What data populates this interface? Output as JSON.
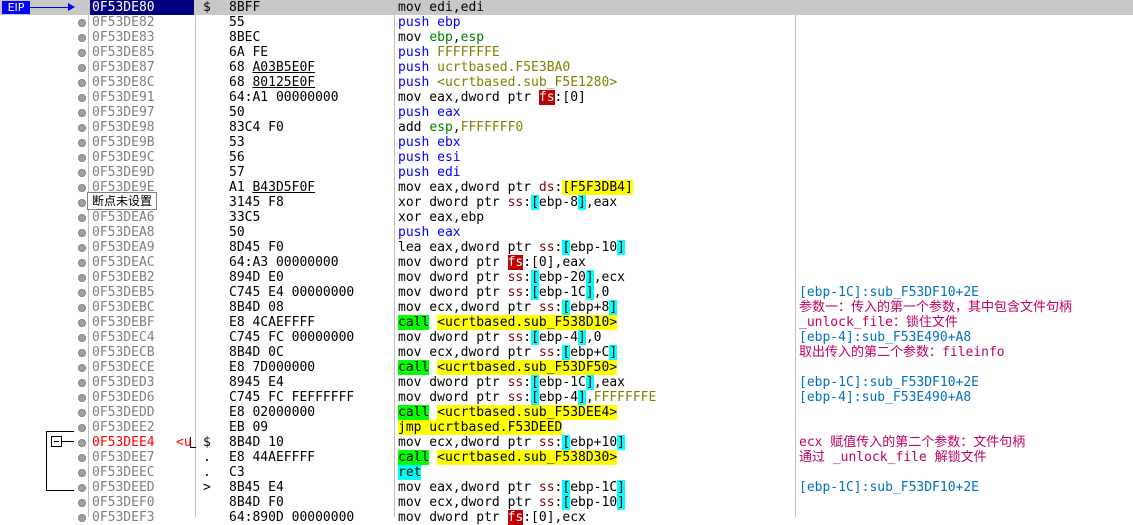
{
  "eip_label": "EIP",
  "tooltip": "断点未设置",
  "row_prefix": "<u",
  "rows": [
    {
      "addr": "0F53DE80",
      "mark": "$",
      "bytes": "8BFF",
      "asm": [
        [
          "k-mov",
          "mov edi,edi"
        ]
      ],
      "cmt": "",
      "eip": true
    },
    {
      "addr": "0F53DE82",
      "mark": "",
      "bytes": "55",
      "asm": [
        [
          "k-push",
          "push ebp"
        ]
      ],
      "cmt": ""
    },
    {
      "addr": "0F53DE83",
      "mark": "",
      "bytes": "8BEC",
      "asm": [
        [
          "k-mov",
          "mov "
        ],
        [
          "k-reg",
          "ebp"
        ],
        [
          "k-lit",
          ","
        ],
        [
          "k-reg",
          "esp"
        ]
      ],
      "cmt": ""
    },
    {
      "addr": "0F53DE85",
      "mark": "",
      "bytes": "6A FE",
      "asm": [
        [
          "k-push",
          "push "
        ],
        [
          "k-num",
          "FFFFFFFE"
        ]
      ],
      "cmt": ""
    },
    {
      "addr": "0F53DE87",
      "mark": "",
      "bytes": "68 A03B5E0F",
      "asm": [
        [
          "k-push",
          "push "
        ],
        [
          "k-sym",
          "ucrtbased.F5E3BA0"
        ]
      ],
      "cmt": "",
      "ul": true
    },
    {
      "addr": "0F53DE8C",
      "mark": "",
      "bytes": "68 80125E0F",
      "asm": [
        [
          "k-push",
          "push "
        ],
        [
          "k-sym",
          "<ucrtbased.sub_F5E1280>"
        ]
      ],
      "cmt": "",
      "ul": true
    },
    {
      "addr": "0F53DE91",
      "mark": "",
      "bytes": "64:A1 00000000",
      "asm": [
        [
          "k-mov",
          "mov eax,dword ptr "
        ],
        [
          "k-fs",
          "fs"
        ],
        [
          "k-lit",
          ":[0]"
        ]
      ],
      "cmt": ""
    },
    {
      "addr": "0F53DE97",
      "mark": "",
      "bytes": "50",
      "asm": [
        [
          "k-push",
          "push eax"
        ]
      ],
      "cmt": ""
    },
    {
      "addr": "0F53DE98",
      "mark": "",
      "bytes": "83C4 F0",
      "asm": [
        [
          "k-add",
          "add "
        ],
        [
          "k-reg",
          "esp"
        ],
        [
          "k-lit",
          ","
        ],
        [
          "k-num",
          "FFFFFFF0"
        ]
      ],
      "cmt": ""
    },
    {
      "addr": "0F53DE9B",
      "mark": "",
      "bytes": "53",
      "asm": [
        [
          "k-push",
          "push ebx"
        ]
      ],
      "cmt": ""
    },
    {
      "addr": "0F53DE9C",
      "mark": "",
      "bytes": "56",
      "asm": [
        [
          "k-push",
          "push esi"
        ]
      ],
      "cmt": ""
    },
    {
      "addr": "0F53DE9D",
      "mark": "",
      "bytes": "57",
      "asm": [
        [
          "k-push",
          "push edi"
        ]
      ],
      "cmt": ""
    },
    {
      "addr": "0F53DE9E",
      "mark": "",
      "bytes": "A1 B43D5F0F",
      "asm": [
        [
          "k-mov",
          "mov eax,dword ptr "
        ],
        [
          "k-seg",
          "ds"
        ],
        [
          "k-lit",
          ":"
        ],
        [
          "k-ds",
          "[F5F3DB4]"
        ]
      ],
      "cmt": "",
      "ul": true
    },
    {
      "addr": "0F53DEA3",
      "mark": "",
      "bytes": "3145 F8",
      "asm": [
        [
          "k-xor",
          "xor dword ptr "
        ],
        [
          "k-seg",
          "ss"
        ],
        [
          "k-lit",
          ":"
        ],
        [
          "k-brk",
          "["
        ],
        [
          "k-lit",
          "ebp-8"
        ],
        [
          "k-brk",
          "]"
        ],
        [
          "k-lit",
          ",eax"
        ]
      ],
      "cmt": ""
    },
    {
      "addr": "0F53DEA6",
      "mark": "",
      "bytes": "33C5",
      "asm": [
        [
          "k-xor",
          "xor eax,ebp"
        ]
      ],
      "cmt": ""
    },
    {
      "addr": "0F53DEA8",
      "mark": "",
      "bytes": "50",
      "asm": [
        [
          "k-push",
          "push eax"
        ]
      ],
      "cmt": ""
    },
    {
      "addr": "0F53DEA9",
      "mark": "",
      "bytes": "8D45 F0",
      "asm": [
        [
          "k-lea",
          "lea eax,dword ptr "
        ],
        [
          "k-seg",
          "ss"
        ],
        [
          "k-lit",
          ":"
        ],
        [
          "k-brk",
          "["
        ],
        [
          "k-lit",
          "ebp-10"
        ],
        [
          "k-brk",
          "]"
        ]
      ],
      "cmt": ""
    },
    {
      "addr": "0F53DEAC",
      "mark": "",
      "bytes": "64:A3 00000000",
      "asm": [
        [
          "k-mov",
          "mov dword ptr "
        ],
        [
          "k-fs",
          "fs"
        ],
        [
          "k-lit",
          ":[0],eax"
        ]
      ],
      "cmt": ""
    },
    {
      "addr": "0F53DEB2",
      "mark": "",
      "bytes": "894D E0",
      "asm": [
        [
          "k-mov",
          "mov dword ptr "
        ],
        [
          "k-seg",
          "ss"
        ],
        [
          "k-lit",
          ":"
        ],
        [
          "k-brk",
          "["
        ],
        [
          "k-lit",
          "ebp-20"
        ],
        [
          "k-brk",
          "]"
        ],
        [
          "k-lit",
          ",ecx"
        ]
      ],
      "cmt": ""
    },
    {
      "addr": "0F53DEB5",
      "mark": "",
      "bytes": "C745 E4 00000000",
      "asm": [
        [
          "k-mov",
          "mov dword ptr "
        ],
        [
          "k-seg",
          "ss"
        ],
        [
          "k-lit",
          ":"
        ],
        [
          "k-brk",
          "["
        ],
        [
          "k-lit",
          "ebp-1C"
        ],
        [
          "k-brk",
          "]"
        ],
        [
          "k-lit",
          ",0"
        ]
      ],
      "cmt": "[ebp-1C]:sub_F53DF10+2E",
      "cc": "cm-blue"
    },
    {
      "addr": "0F53DEBC",
      "mark": "",
      "bytes": "8B4D 08",
      "asm": [
        [
          "k-mov",
          "mov ecx,dword ptr "
        ],
        [
          "k-seg",
          "ss"
        ],
        [
          "k-lit",
          ":"
        ],
        [
          "k-brk",
          "["
        ],
        [
          "k-lit",
          "ebp+8"
        ],
        [
          "k-brk",
          "]"
        ]
      ],
      "cmt": "参数一：传入的第一个参数，其中包含文件句柄",
      "cc": "cm-red"
    },
    {
      "addr": "0F53DEBF",
      "mark": "",
      "bytes": "E8 4CAEFFFF",
      "asm": [
        [
          "k-call",
          "call"
        ],
        [
          "k-lit",
          " "
        ],
        [
          "k-callt",
          "<ucrtbased.sub_F538D10>"
        ]
      ],
      "cmt": "_unlock_file：锁住文件",
      "cc": "cm-red"
    },
    {
      "addr": "0F53DEC4",
      "mark": "",
      "bytes": "C745 FC 00000000",
      "asm": [
        [
          "k-mov",
          "mov dword ptr "
        ],
        [
          "k-seg",
          "ss"
        ],
        [
          "k-lit",
          ":"
        ],
        [
          "k-brk",
          "["
        ],
        [
          "k-lit",
          "ebp-4"
        ],
        [
          "k-brk",
          "]"
        ],
        [
          "k-lit",
          ",0"
        ]
      ],
      "cmt": "[ebp-4]:sub_F53E490+A8",
      "cc": "cm-blue"
    },
    {
      "addr": "0F53DECB",
      "mark": "",
      "bytes": "8B4D 0C",
      "asm": [
        [
          "k-mov",
          "mov ecx,dword ptr "
        ],
        [
          "k-seg",
          "ss"
        ],
        [
          "k-lit",
          ":"
        ],
        [
          "k-brk",
          "["
        ],
        [
          "k-lit",
          "ebp+C"
        ],
        [
          "k-brk",
          "]"
        ]
      ],
      "cmt": "取出传入的第二个参数：fileinfo",
      "cc": "cm-red"
    },
    {
      "addr": "0F53DECE",
      "mark": "",
      "bytes": "E8 7D000000",
      "asm": [
        [
          "k-call",
          "call"
        ],
        [
          "k-lit",
          " "
        ],
        [
          "k-callt",
          "<ucrtbased.sub_F53DF50>"
        ]
      ],
      "cmt": ""
    },
    {
      "addr": "0F53DED3",
      "mark": "",
      "bytes": "8945 E4",
      "asm": [
        [
          "k-mov",
          "mov dword ptr "
        ],
        [
          "k-seg",
          "ss"
        ],
        [
          "k-lit",
          ":"
        ],
        [
          "k-brk",
          "["
        ],
        [
          "k-lit",
          "ebp-1C"
        ],
        [
          "k-brk",
          "]"
        ],
        [
          "k-lit",
          ",eax"
        ]
      ],
      "cmt": "[ebp-1C]:sub_F53DF10+2E",
      "cc": "cm-blue"
    },
    {
      "addr": "0F53DED6",
      "mark": "",
      "bytes": "C745 FC FEFFFFFF",
      "asm": [
        [
          "k-mov",
          "mov dword ptr "
        ],
        [
          "k-seg",
          "ss"
        ],
        [
          "k-lit",
          ":"
        ],
        [
          "k-brk",
          "["
        ],
        [
          "k-lit",
          "ebp-4"
        ],
        [
          "k-brk",
          "]"
        ],
        [
          "k-lit",
          ","
        ],
        [
          "k-num",
          "FFFFFFFE"
        ]
      ],
      "cmt": "[ebp-4]:sub_F53E490+A8",
      "cc": "cm-blue"
    },
    {
      "addr": "0F53DEDD",
      "mark": "",
      "bytes": "E8 02000000",
      "asm": [
        [
          "k-call",
          "call"
        ],
        [
          "k-lit",
          " "
        ],
        [
          "k-callt",
          "<ucrtbased.sub_F53DEE4>"
        ]
      ],
      "cmt": ""
    },
    {
      "addr": "0F53DEE2",
      "mark": "",
      "bytes": "EB 09",
      "asm": [
        [
          "k-jmpt",
          "jmp ucrtbased.F53DEED"
        ]
      ],
      "cmt": ""
    },
    {
      "addr": "0F53DEE4",
      "mark": "$",
      "bytes": "8B4D 10",
      "asm": [
        [
          "k-mov",
          "mov ecx,dword ptr "
        ],
        [
          "k-seg",
          "ss"
        ],
        [
          "k-lit",
          ":"
        ],
        [
          "k-brk",
          "["
        ],
        [
          "k-lit",
          "ebp+10"
        ],
        [
          "k-brk",
          "]"
        ]
      ],
      "cmt": "ecx 赋值传入的第二个参数：文件句柄",
      "cc": "cm-red",
      "red": true
    },
    {
      "addr": "0F53DEE7",
      "mark": ".",
      "bytes": "E8 44AEFFFF",
      "asm": [
        [
          "k-call",
          "call"
        ],
        [
          "k-lit",
          " "
        ],
        [
          "k-callt",
          "<ucrtbased.sub_F538D30>"
        ]
      ],
      "cmt": "通过 _unlock_file 解锁文件",
      "cc": "cm-red"
    },
    {
      "addr": "0F53DEEC",
      "mark": ".",
      "bytes": "C3",
      "asm": [
        [
          "k-ret",
          "ret"
        ]
      ],
      "cmt": ""
    },
    {
      "addr": "0F53DEED",
      "mark": ">",
      "bytes": "8B45 E4",
      "asm": [
        [
          "k-mov",
          "mov eax,dword ptr "
        ],
        [
          "k-seg",
          "ss"
        ],
        [
          "k-lit",
          ":"
        ],
        [
          "k-brk",
          "["
        ],
        [
          "k-lit",
          "ebp-1C"
        ],
        [
          "k-brk",
          "]"
        ]
      ],
      "cmt": "[ebp-1C]:sub_F53DF10+2E",
      "cc": "cm-blue"
    },
    {
      "addr": "0F53DEF0",
      "mark": "",
      "bytes": "8B4D F0",
      "asm": [
        [
          "k-mov",
          "mov ecx,dword ptr "
        ],
        [
          "k-seg",
          "ss"
        ],
        [
          "k-lit",
          ":"
        ],
        [
          "k-brk",
          "["
        ],
        [
          "k-lit",
          "ebp-10"
        ],
        [
          "k-brk",
          "]"
        ]
      ],
      "cmt": ""
    },
    {
      "addr": "0F53DEF3",
      "mark": "",
      "bytes": "64:890D 00000000",
      "asm": [
        [
          "k-mov",
          "mov dword ptr "
        ],
        [
          "k-fs",
          "fs"
        ],
        [
          "k-lit",
          ":[0],ecx"
        ]
      ],
      "cmt": ""
    }
  ]
}
